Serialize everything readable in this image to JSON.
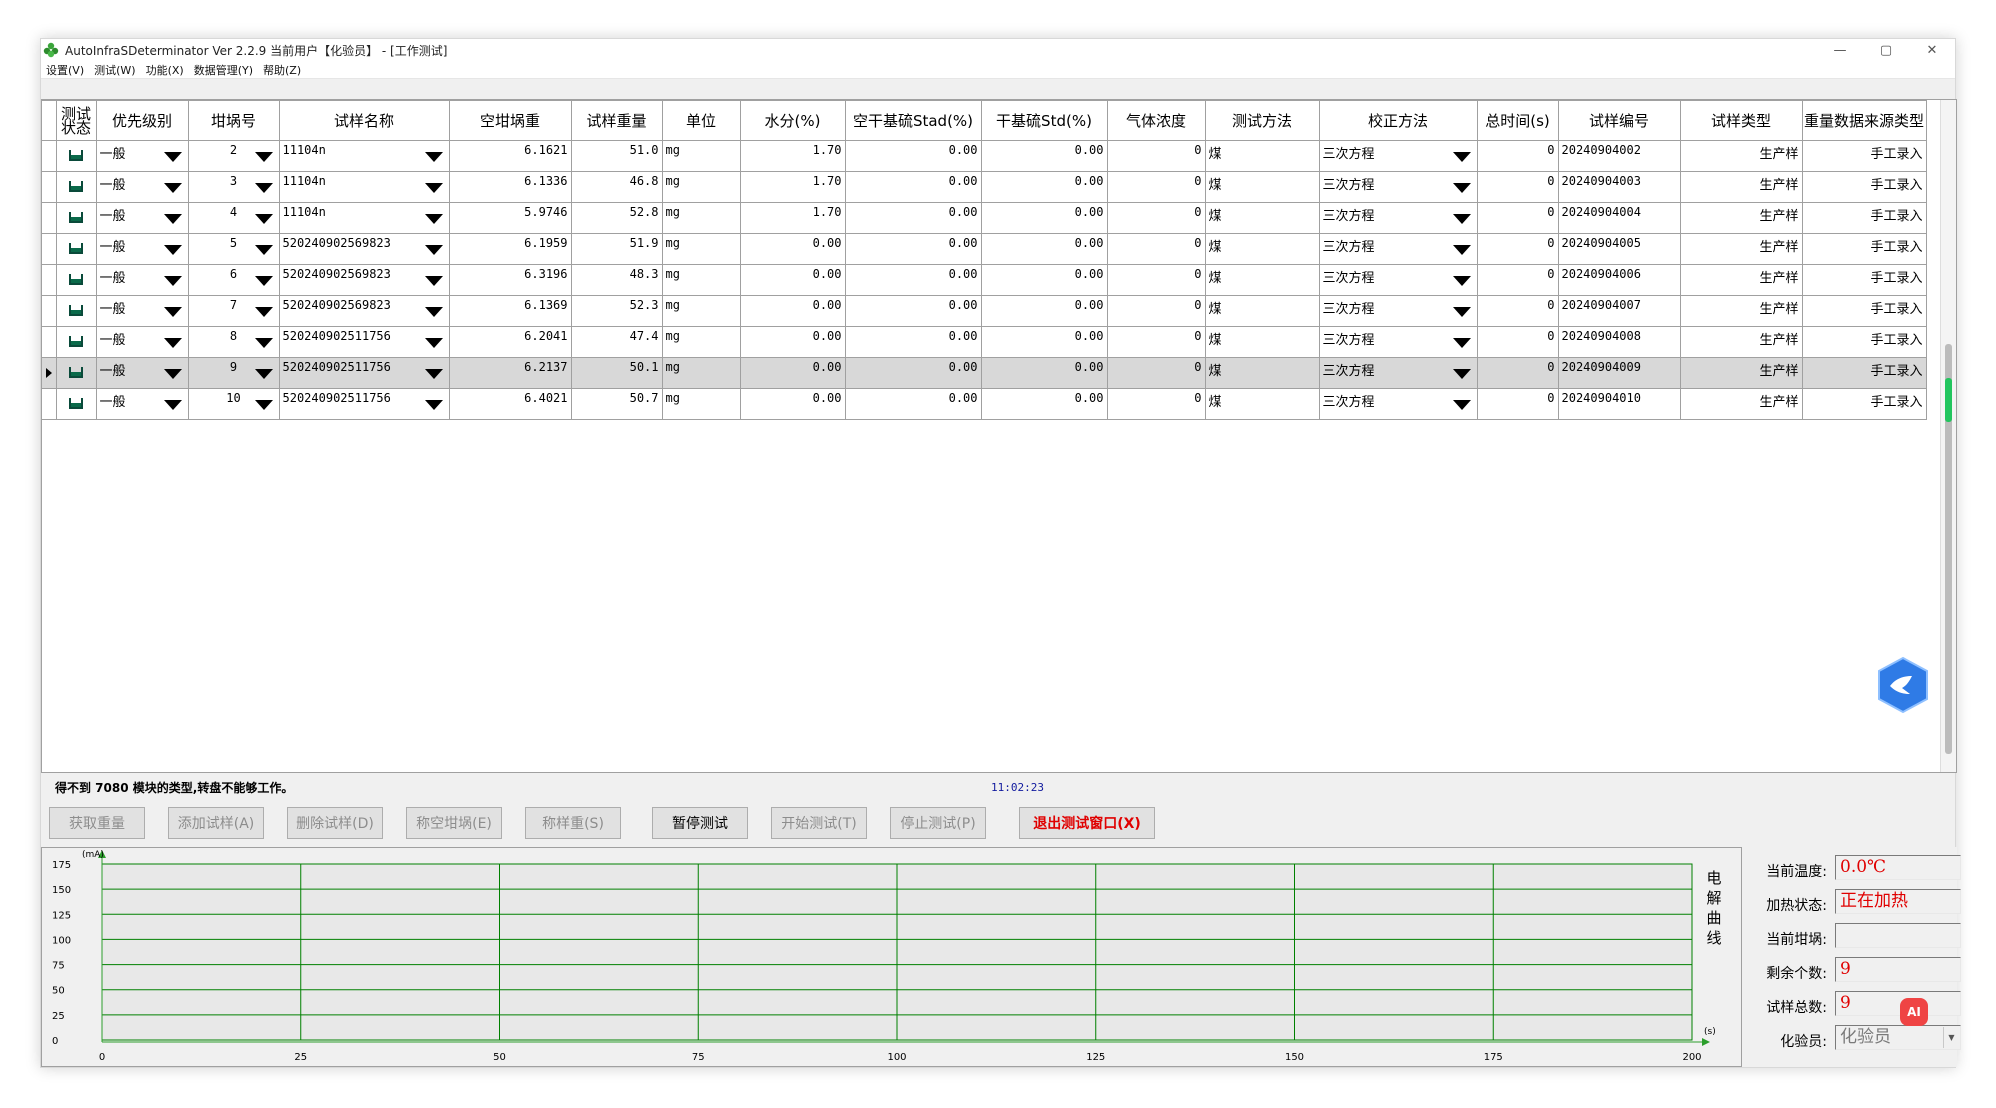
{
  "window": {
    "title": "AutoInfraSDeterminator Ver 2.2.9  当前用户【化验员】 - [工作测试]",
    "controls": [
      "—",
      "▢",
      "✕"
    ]
  },
  "menu": [
    "设置(V)",
    "测试(W)",
    "功能(X)",
    "数据管理(Y)",
    "帮助(Z)"
  ],
  "table": {
    "columns": [
      "测试状态",
      "优先级别",
      "坩埚号",
      "试样名称",
      "空坩埚重",
      "试样重量",
      "单位",
      "水分(%)",
      "空干基硫Stad(%)",
      "干基硫Std(%)",
      "气体浓度",
      "测试方法",
      "校正方法",
      "总时间(s)",
      "试样编号",
      "试样类型",
      "重量数据来源类型"
    ],
    "rows": [
      {
        "priority": "一般",
        "crucible": "2",
        "name": "11104n",
        "empty_weight": "6.1621",
        "sample_weight": "51.0",
        "unit": "mg",
        "moisture": "1.70",
        "stad": "0.00",
        "std": "0.00",
        "gas": "0",
        "method": "煤",
        "correction": "三次方程",
        "time": "0",
        "sample_no": "20240904002",
        "type": "生产样",
        "source": "手工录入"
      },
      {
        "priority": "一般",
        "crucible": "3",
        "name": "11104n",
        "empty_weight": "6.1336",
        "sample_weight": "46.8",
        "unit": "mg",
        "moisture": "1.70",
        "stad": "0.00",
        "std": "0.00",
        "gas": "0",
        "method": "煤",
        "correction": "三次方程",
        "time": "0",
        "sample_no": "20240904003",
        "type": "生产样",
        "source": "手工录入"
      },
      {
        "priority": "一般",
        "crucible": "4",
        "name": "11104n",
        "empty_weight": "5.9746",
        "sample_weight": "52.8",
        "unit": "mg",
        "moisture": "1.70",
        "stad": "0.00",
        "std": "0.00",
        "gas": "0",
        "method": "煤",
        "correction": "三次方程",
        "time": "0",
        "sample_no": "20240904004",
        "type": "生产样",
        "source": "手工录入"
      },
      {
        "priority": "一般",
        "crucible": "5",
        "name": "520240902569823",
        "empty_weight": "6.1959",
        "sample_weight": "51.9",
        "unit": "mg",
        "moisture": "0.00",
        "stad": "0.00",
        "std": "0.00",
        "gas": "0",
        "method": "煤",
        "correction": "三次方程",
        "time": "0",
        "sample_no": "20240904005",
        "type": "生产样",
        "source": "手工录入"
      },
      {
        "priority": "一般",
        "crucible": "6",
        "name": "520240902569823",
        "empty_weight": "6.3196",
        "sample_weight": "48.3",
        "unit": "mg",
        "moisture": "0.00",
        "stad": "0.00",
        "std": "0.00",
        "gas": "0",
        "method": "煤",
        "correction": "三次方程",
        "time": "0",
        "sample_no": "20240904006",
        "type": "生产样",
        "source": "手工录入"
      },
      {
        "priority": "一般",
        "crucible": "7",
        "name": "520240902569823",
        "empty_weight": "6.1369",
        "sample_weight": "52.3",
        "unit": "mg",
        "moisture": "0.00",
        "stad": "0.00",
        "std": "0.00",
        "gas": "0",
        "method": "煤",
        "correction": "三次方程",
        "time": "0",
        "sample_no": "20240904007",
        "type": "生产样",
        "source": "手工录入"
      },
      {
        "priority": "一般",
        "crucible": "8",
        "name": "520240902511756",
        "empty_weight": "6.2041",
        "sample_weight": "47.4",
        "unit": "mg",
        "moisture": "0.00",
        "stad": "0.00",
        "std": "0.00",
        "gas": "0",
        "method": "煤",
        "correction": "三次方程",
        "time": "0",
        "sample_no": "20240904008",
        "type": "生产样",
        "source": "手工录入"
      },
      {
        "priority": "一般",
        "crucible": "9",
        "name": "520240902511756",
        "empty_weight": "6.2137",
        "sample_weight": "50.1",
        "unit": "mg",
        "moisture": "0.00",
        "stad": "0.00",
        "std": "0.00",
        "gas": "0",
        "method": "煤",
        "correction": "三次方程",
        "time": "0",
        "sample_no": "20240904009",
        "type": "生产样",
        "source": "手工录入"
      },
      {
        "priority": "一般",
        "crucible": "10",
        "name": "520240902511756",
        "empty_weight": "6.4021",
        "sample_weight": "50.7",
        "unit": "mg",
        "moisture": "0.00",
        "stad": "0.00",
        "std": "0.00",
        "gas": "0",
        "method": "煤",
        "correction": "三次方程",
        "time": "0",
        "sample_no": "20240904010",
        "type": "生产样",
        "source": "手工录入"
      }
    ],
    "selected_row": 7
  },
  "status": {
    "message": "得不到 7080 模块的类型,转盘不能够工作。",
    "time": "11:02:23"
  },
  "buttons": [
    {
      "label": "获取重量",
      "enabled": false
    },
    {
      "label": "添加试样(A)",
      "enabled": false
    },
    {
      "label": "删除试样(D)",
      "enabled": false
    },
    {
      "label": "称空坩埚(E)",
      "enabled": false
    },
    {
      "label": "称样重(S)",
      "enabled": false
    },
    {
      "label": "暂停测试",
      "enabled": true
    },
    {
      "label": "开始测试(T)",
      "enabled": false
    },
    {
      "label": "停止测试(P)",
      "enabled": false
    },
    {
      "label": "退出测试窗口(X)",
      "enabled": true,
      "danger": true
    }
  ],
  "chart_data": {
    "type": "line",
    "title": "电解曲线",
    "xlabel": "(s)",
    "ylabel": "(mA)",
    "xlim": [
      0,
      200
    ],
    "ylim": [
      0,
      175
    ],
    "x_ticks": [
      0,
      25,
      50,
      75,
      100,
      125,
      150,
      175,
      200
    ],
    "y_ticks": [
      0,
      25,
      50,
      75,
      100,
      125,
      150,
      175
    ],
    "grid": true,
    "grid_color": "#008000",
    "series": []
  },
  "info": {
    "temperature_label": "当前温度:",
    "temperature_value": "0.0℃",
    "heating_label": "加热状态:",
    "heating_value": "正在加热",
    "crucible_label": "当前坩埚:",
    "crucible_value": "",
    "remaining_label": "剩余个数:",
    "remaining_value": "9",
    "total_label": "试样总数:",
    "total_value": "9",
    "operator_label": "化验员:",
    "operator_value": "化验员"
  },
  "ai_badge": "AI",
  "colors": {
    "accent_red": "#e00000",
    "grid_green": "#008000",
    "selected_row": "#d8d8d8"
  }
}
